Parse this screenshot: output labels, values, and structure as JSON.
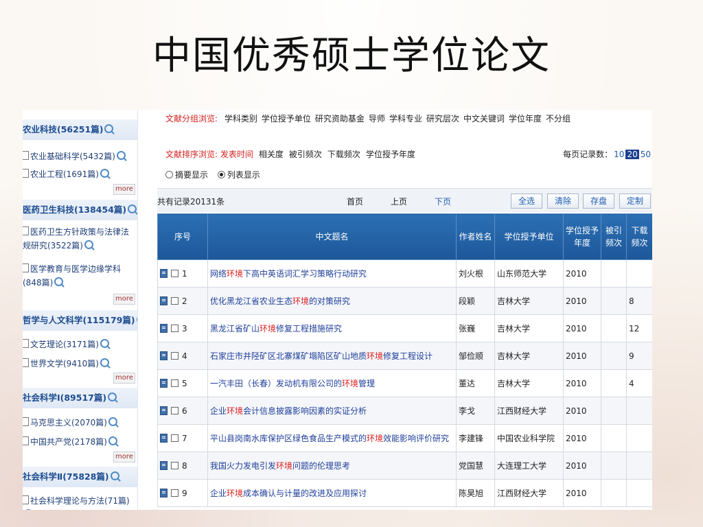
{
  "slide": {
    "title": "中国优秀硕士学位论文"
  },
  "sidebar": {
    "categories": [
      {
        "head": "农业科技(56251篇)",
        "items": [
          "农业基础科学(5432篇)",
          "农业工程(1691篇)"
        ],
        "more": "more"
      },
      {
        "head": "医药卫生科技(138454篇)",
        "items": [
          "医药卫生方针政策与法律法规研究(3522篇)",
          "医学教育与医学边缘学科(848篇)"
        ],
        "more": "more"
      },
      {
        "head": "哲学与人文科学(115179篇)",
        "items": [
          "文艺理论(3171篇)",
          "世界文学(9410篇)"
        ],
        "more": "more"
      },
      {
        "head": "社会科学Ⅰ(89517篇)",
        "items": [
          "马克思主义(2070篇)",
          "中国共产党(2178篇)"
        ],
        "more": "more"
      },
      {
        "head": "社会科学Ⅱ(75828篇)",
        "items": [
          "社会科学理论与方法(71篇)"
        ]
      }
    ]
  },
  "main": {
    "group_browse_label": "文献分组浏览:",
    "group_browse_options": [
      "学科类别",
      "学位授予单位",
      "研究资助基金",
      "导师",
      "学科专业",
      "研究层次",
      "中文关键词",
      "学位年度",
      "不分组"
    ],
    "sort_label": "文献排序浏览:",
    "sort_options": [
      "发表时间",
      "相关度",
      "被引频次",
      "下载频次",
      "学位授予年度"
    ],
    "per_page_label": "每页记录数：",
    "per_page_options": [
      "10",
      "20",
      "50"
    ],
    "per_page_selected": "20",
    "display_modes": [
      "摘要显示",
      "列表显示"
    ],
    "display_selected": "列表显示",
    "total_records": "共有记录20131条",
    "nav": {
      "first": "首页",
      "prev": "上页",
      "next": "下页"
    },
    "buttons": {
      "select_all": "全选",
      "clear": "清除",
      "save": "存盘",
      "custom": "定制"
    },
    "table_headers": [
      "序号",
      "中文题名",
      "作者姓名",
      "学位授予单位",
      "学位授予年度",
      "被引频次",
      "下载频次"
    ],
    "rows": [
      {
        "no": "1",
        "title_pre": "网络",
        "kw": "环境",
        "title_post": "下高中英语词汇学习策略行动研究",
        "author": "刘火根",
        "unit": "山东师范大学",
        "year": "2010",
        "cited": "",
        "downloads": ""
      },
      {
        "no": "2",
        "title_pre": "优化黑龙江省农业生态",
        "kw": "环境",
        "title_post": "的对策研究",
        "author": "段颖",
        "unit": "吉林大学",
        "year": "2010",
        "cited": "",
        "downloads": "8"
      },
      {
        "no": "3",
        "title_pre": "黑龙江省矿山",
        "kw": "环境",
        "title_post": "修复工程措施研究",
        "author": "张巍",
        "unit": "吉林大学",
        "year": "2010",
        "cited": "",
        "downloads": "12"
      },
      {
        "no": "4",
        "title_pre": "石家庄市井陉矿区北寨煤矿塌陷区矿山地质",
        "kw": "环境",
        "title_post": "修复工程设计",
        "author": "邹俭顺",
        "unit": "吉林大学",
        "year": "2010",
        "cited": "",
        "downloads": "9"
      },
      {
        "no": "5",
        "title_pre": "一汽丰田（长春）发动机有限公司的",
        "kw": "环境",
        "title_post": "管理",
        "author": "董达",
        "unit": "吉林大学",
        "year": "2010",
        "cited": "",
        "downloads": "4"
      },
      {
        "no": "6",
        "title_pre": "企业",
        "kw": "环境",
        "title_post": "会计信息披露影响因素的实证分析",
        "author": "李戈",
        "unit": "江西财经大学",
        "year": "2010",
        "cited": "",
        "downloads": ""
      },
      {
        "no": "7",
        "title_pre": "平山县岗南水库保护区绿色食品生产模式的",
        "kw": "环境",
        "title_post": "效能影响评价研究",
        "author": "李建锋",
        "unit": "中国农业科学院",
        "year": "2010",
        "cited": "",
        "downloads": ""
      },
      {
        "no": "8",
        "title_pre": "我国火力发电引发",
        "kw": "环境",
        "title_post": "问题的伦理思考",
        "author": "党国慧",
        "unit": "大连理工大学",
        "year": "2010",
        "cited": "",
        "downloads": ""
      },
      {
        "no": "9",
        "title_pre": "企业",
        "kw": "环境",
        "title_post": "成本确认与计量的改进及应用探讨",
        "author": "陈昊旭",
        "unit": "江西财经大学",
        "year": "2010",
        "cited": "",
        "downloads": ""
      }
    ]
  }
}
